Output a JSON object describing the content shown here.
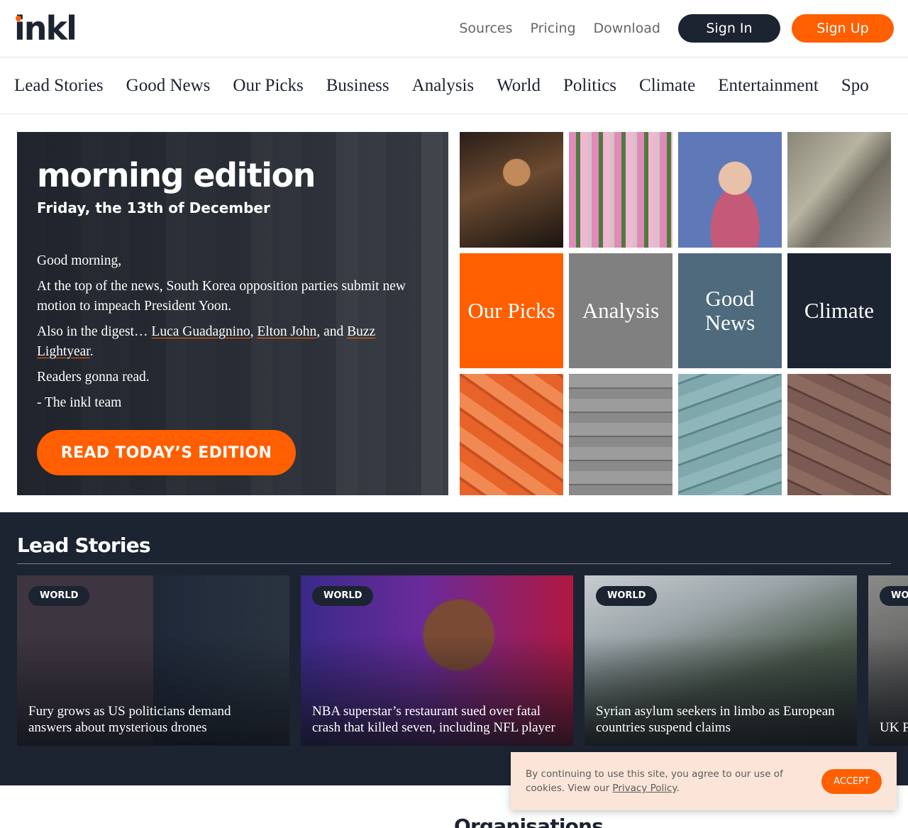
{
  "header": {
    "logo": "inkl",
    "nav": [
      "Sources",
      "Pricing",
      "Download"
    ],
    "sign_in": "Sign In",
    "sign_up": "Sign Up"
  },
  "categories": [
    "Lead Stories",
    "Good News",
    "Our Picks",
    "Business",
    "Analysis",
    "World",
    "Politics",
    "Climate",
    "Entertainment",
    "Spo"
  ],
  "hero": {
    "title": "morning edition",
    "date": "Friday, the 13th of December",
    "greeting": "Good morning,",
    "top_news": "At the top of the news, South Korea opposition parties submit new motion to impeach President Yoon.",
    "digest_prefix": "Also in the digest…",
    "digest_links": [
      "Luca Guadagnino",
      "Elton John",
      "Buzz Lightyear"
    ],
    "digest_and": "and",
    "tagline": "Readers gonna read.",
    "signoff": "- The inkl team",
    "cta": "READ TODAY’S EDITION"
  },
  "tiles": {
    "photos": [
      "guitarist-photo",
      "flower-wreaths-photo",
      "singer-photo",
      "river-delta-photo"
    ],
    "categories": [
      {
        "label": "Our Picks",
        "color": "#ff5f00"
      },
      {
        "label": "Analysis",
        "color": "#808080"
      },
      {
        "label": "Good News",
        "color": "#4e6a7c"
      },
      {
        "label": "Climate",
        "color": "#1c2331"
      }
    ],
    "papers": [
      "#e8632a",
      "#7d7d7d",
      "#6f9aa0",
      "#6b4d47"
    ]
  },
  "lead": {
    "title": "Lead Stories",
    "cards": [
      {
        "badge": "WORLD",
        "headline": "Fury grows as US politicians demand answers about mysterious drones"
      },
      {
        "badge": "WORLD",
        "headline": "NBA superstar’s restaurant sued over fatal crash that killed seven, including NFL player"
      },
      {
        "badge": "WORLD",
        "headline": "Syrian asylum seekers in limbo as European countries suspend claims"
      },
      {
        "badge": "WORLD",
        "headline": "UK Pu"
      }
    ]
  },
  "cookie": {
    "text": "By continuing to use this site, you agree to our use of cookies. View our",
    "link": "Privacy Policy",
    "end": ".",
    "accept": "ACCEPT"
  },
  "bottom_heading": "Organisations"
}
